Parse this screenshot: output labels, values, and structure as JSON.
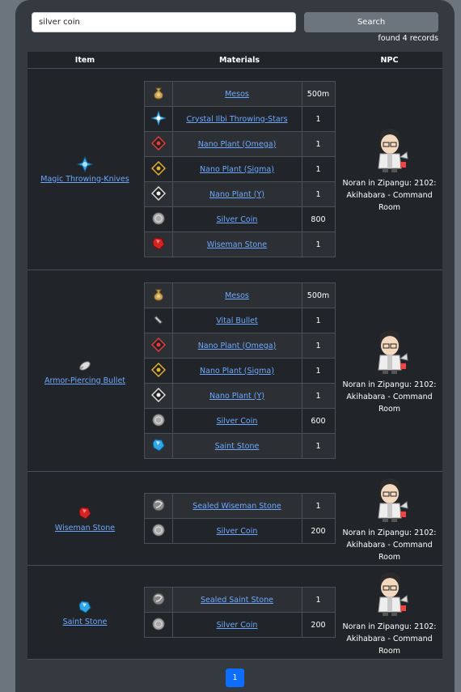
{
  "search": {
    "value": "silver coin",
    "button_label": "Search",
    "found_text": "found 4 records"
  },
  "table": {
    "headers": [
      "Item",
      "Materials",
      "NPC"
    ]
  },
  "rows": [
    {
      "item": {
        "name": "Magic Throwing-Knives",
        "icon": "throwing-knives-icon"
      },
      "materials": [
        {
          "name": "Mesos",
          "qty": "500m",
          "icon": "mesos-bag-icon"
        },
        {
          "name": "Crystal Ilbi Throwing-Stars",
          "qty": "1",
          "icon": "throwing-star-icon"
        },
        {
          "name": "Nano Plant (Omega)",
          "qty": "1",
          "icon": "nano-plant-omega-icon"
        },
        {
          "name": "Nano Plant (Sigma)",
          "qty": "1",
          "icon": "nano-plant-sigma-icon"
        },
        {
          "name": "Nano Plant (Y)",
          "qty": "1",
          "icon": "nano-plant-y-icon"
        },
        {
          "name": "Silver Coin",
          "qty": "800",
          "icon": "silver-coin-icon"
        },
        {
          "name": "Wiseman Stone",
          "qty": "1",
          "icon": "wiseman-stone-icon"
        }
      ],
      "npc": "Noran in Zipangu: 2102: Akihabara - Command Room"
    },
    {
      "item": {
        "name": "Armor-Piercing Bullet",
        "icon": "bullet-icon"
      },
      "materials": [
        {
          "name": "Mesos",
          "qty": "500m",
          "icon": "mesos-bag-icon"
        },
        {
          "name": "Vital Bullet",
          "qty": "1",
          "icon": "vital-bullet-icon"
        },
        {
          "name": "Nano Plant (Omega)",
          "qty": "1",
          "icon": "nano-plant-omega-icon"
        },
        {
          "name": "Nano Plant (Sigma)",
          "qty": "1",
          "icon": "nano-plant-sigma-icon"
        },
        {
          "name": "Nano Plant (Y)",
          "qty": "1",
          "icon": "nano-plant-y-icon"
        },
        {
          "name": "Silver Coin",
          "qty": "600",
          "icon": "silver-coin-icon"
        },
        {
          "name": "Saint Stone",
          "qty": "1",
          "icon": "saint-stone-icon"
        }
      ],
      "npc": "Noran in Zipangu: 2102: Akihabara - Command Room"
    },
    {
      "item": {
        "name": "Wiseman Stone",
        "icon": "wiseman-stone-icon"
      },
      "materials": [
        {
          "name": "Sealed Wiseman Stone",
          "qty": "1",
          "icon": "sealed-stone-icon"
        },
        {
          "name": "Silver Coin",
          "qty": "200",
          "icon": "silver-coin-icon"
        }
      ],
      "npc": "Noran in Zipangu: 2102: Akihabara - Command Room"
    },
    {
      "item": {
        "name": "Saint Stone",
        "icon": "saint-stone-icon"
      },
      "materials": [
        {
          "name": "Sealed Saint Stone",
          "qty": "1",
          "icon": "sealed-stone-icon"
        },
        {
          "name": "Silver Coin",
          "qty": "200",
          "icon": "silver-coin-icon"
        }
      ],
      "npc": "Noran in Zipangu: 2102: Akihabara - Command Room"
    }
  ],
  "pagination": {
    "current": "1"
  },
  "colors": {
    "panel": "#343a40",
    "table_bg": "#212529",
    "link": "#6ea8fe",
    "page_active": "#0d6efd"
  }
}
